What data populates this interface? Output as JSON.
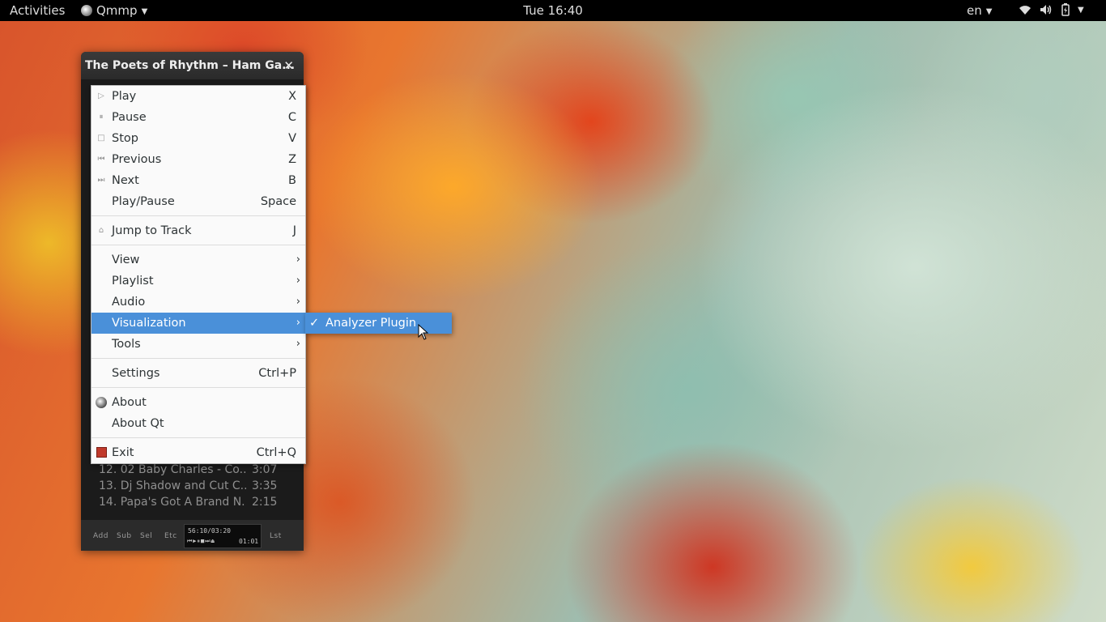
{
  "topbar": {
    "activities": "Activities",
    "app_name": "Qmmp",
    "clock": "Tue 16:40",
    "language": "en",
    "tray_icons": [
      "wifi-icon",
      "volume-icon",
      "battery-icon",
      "system-menu-icon"
    ]
  },
  "qmmp": {
    "title": "The Poets of Rhythm – Ham Ga...",
    "close": "✕",
    "tracks": [
      {
        "num": "12.",
        "title": "02 Baby Charles - Co...",
        "time": "3:07"
      },
      {
        "num": "13.",
        "title": "Dj Shadow and Cut C...",
        "time": "3:35"
      },
      {
        "num": "14.",
        "title": "Papa's Got A Brand N...",
        "time": "2:15"
      }
    ],
    "bottom": {
      "add": "Add",
      "sub": "Sub",
      "sel": "Sel",
      "etc": "Etc",
      "lst": "Lst",
      "total_time": "56:10/03:20",
      "position": "01:01"
    }
  },
  "menu": {
    "items": [
      {
        "label": "Play",
        "shortcut": "X"
      },
      {
        "label": "Pause",
        "shortcut": "C"
      },
      {
        "label": "Stop",
        "shortcut": "V"
      },
      {
        "label": "Previous",
        "shortcut": "Z"
      },
      {
        "label": "Next",
        "shortcut": "B"
      },
      {
        "label": "Play/Pause",
        "shortcut": "Space"
      },
      {
        "label": "Jump to Track",
        "shortcut": "J"
      },
      {
        "label": "View",
        "shortcut": ""
      },
      {
        "label": "Playlist",
        "shortcut": ""
      },
      {
        "label": "Audio",
        "shortcut": ""
      },
      {
        "label": "Visualization",
        "shortcut": ""
      },
      {
        "label": "Tools",
        "shortcut": ""
      },
      {
        "label": "Settings",
        "shortcut": "Ctrl+P"
      },
      {
        "label": "About",
        "shortcut": ""
      },
      {
        "label": "About Qt",
        "shortcut": ""
      },
      {
        "label": "Exit",
        "shortcut": "Ctrl+Q"
      }
    ],
    "active_item": "Visualization"
  },
  "submenu": {
    "items": [
      {
        "label": "Analyzer Plugin",
        "checked": true
      }
    ]
  },
  "colors": {
    "menu_highlight": "#4a90d9",
    "topbar_bg": "#000000",
    "menu_bg": "#fafafa"
  }
}
